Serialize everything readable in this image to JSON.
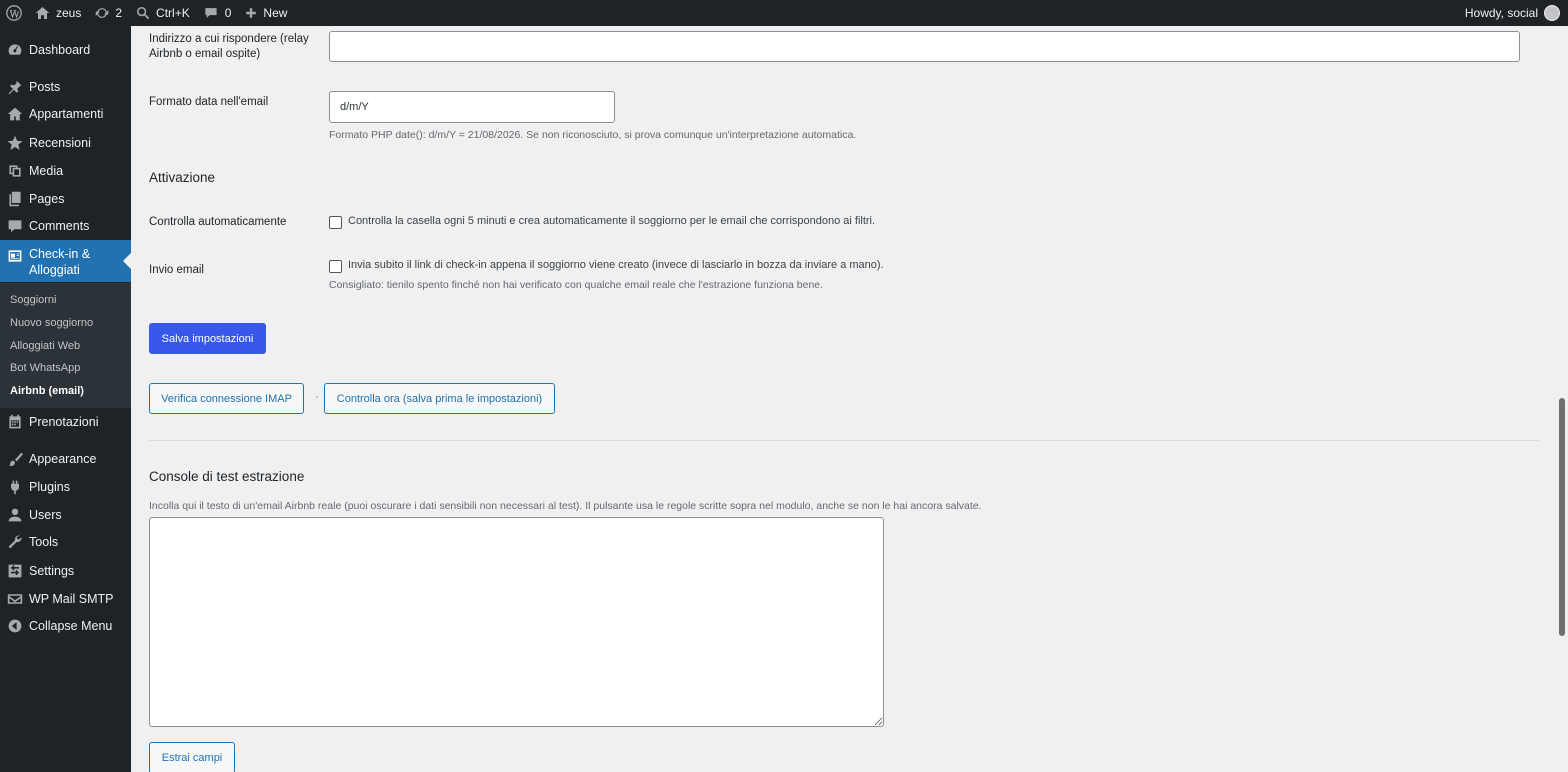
{
  "adminbar": {
    "site_name": "zeus",
    "updates_count": "2",
    "search_shortcut": "Ctrl+K",
    "comments_count": "0",
    "new_label": "New",
    "howdy": "Howdy, social"
  },
  "sidebar": {
    "items": [
      {
        "label": "Dashboard",
        "icon": "dashboard-icon"
      },
      {
        "label": "Posts",
        "icon": "pin-icon"
      },
      {
        "label": "Appartamenti",
        "icon": "building-icon"
      },
      {
        "label": "Recensioni",
        "icon": "star-icon"
      },
      {
        "label": "Media",
        "icon": "media-icon"
      },
      {
        "label": "Pages",
        "icon": "pages-icon"
      },
      {
        "label": "Comments",
        "icon": "comment-icon"
      },
      {
        "label": "Check-in & Alloggiati",
        "icon": "id-card-icon"
      },
      {
        "label": "Prenotazioni",
        "icon": "calendar-icon"
      },
      {
        "label": "Appearance",
        "icon": "brush-icon"
      },
      {
        "label": "Plugins",
        "icon": "plugin-icon"
      },
      {
        "label": "Users",
        "icon": "user-icon"
      },
      {
        "label": "Tools",
        "icon": "wrench-icon"
      },
      {
        "label": "Settings",
        "icon": "settings-icon"
      },
      {
        "label": "WP Mail SMTP",
        "icon": "mail-icon"
      },
      {
        "label": "Collapse Menu",
        "icon": "collapse-icon"
      }
    ],
    "submenu": [
      "Soggiorni",
      "Nuovo soggiorno",
      "Alloggiati Web",
      "Bot WhatsApp",
      "Airbnb (email)"
    ]
  },
  "form": {
    "reply_label": "Indirizzo a cui rispondere (relay Airbnb o email ospite)",
    "reply_value": "",
    "date_format_label": "Formato data nell'email",
    "date_format_value": "d/m/Y",
    "date_format_desc": "Formato PHP date(): d/m/Y = 21/08/2026. Se non riconosciuto, si prova comunque un'interpretazione automatica.",
    "activation_heading": "Attivazione",
    "auto_check_label": "Controlla automaticamente",
    "auto_check_text": "Controlla la casella ogni 5 minuti e crea automaticamente il soggiorno per le email che corrispondono ai filtri.",
    "send_email_label": "Invio email",
    "send_email_text": "Invia subito il link di check-in appena il soggiorno viene creato (invece di lasciarlo in bozza da inviare a mano).",
    "send_email_desc": "Consigliato: tienilo spento finché non hai verificato con qualche email reale che l'estrazione funziona bene.",
    "save_button": "Salva impostazioni",
    "verify_imap_button": "Verifica connessione IMAP",
    "dot_sep": "·",
    "check_now_button": "Controlla ora (salva prima le impostazioni)"
  },
  "console": {
    "heading": "Console di test estrazione",
    "desc": "Incolla qui il testo di un'email Airbnb reale (puoi oscurare i dati sensibili non necessari al test). Il pulsante usa le regole scritte sopra nel modulo, anche se non le hai ancora salvate.",
    "extract_button": "Estrai campi"
  }
}
